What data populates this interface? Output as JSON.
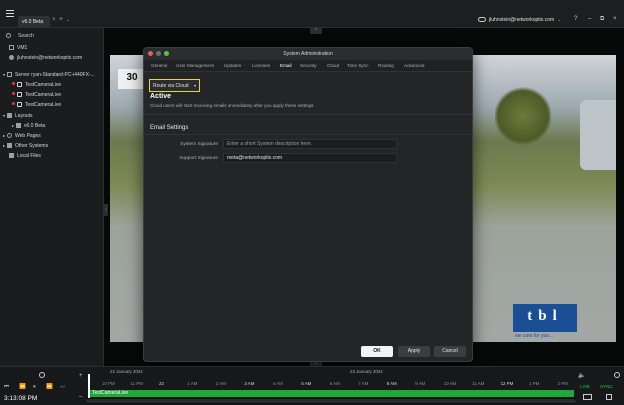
{
  "topbar": {
    "tab_label": "v6.0 Beta",
    "tab_close": "×",
    "tab_add": "+",
    "tab_more": "⌄",
    "user_email": "jluhnstein@networkoptix.com",
    "user_chevron": "⌄",
    "help": "?",
    "minimize": "–",
    "restore": "⧉",
    "close": "×"
  },
  "sidebar": {
    "search_label": "Search",
    "items": [
      {
        "label": "VM1"
      },
      {
        "label": "jluhnstein@networkoptix.com"
      },
      {
        "label": "Server ryan-Standard-PC-i440FX-..."
      },
      {
        "label": "TestCameraLive"
      },
      {
        "label": "TestCameraLive"
      },
      {
        "label": "TestCameraLive"
      },
      {
        "label": "Layouts"
      },
      {
        "label": "v6.0 Beta"
      },
      {
        "label": "Web Pages"
      },
      {
        "label": "Other Systems"
      },
      {
        "label": "Local Files"
      }
    ]
  },
  "scene": {
    "sign_text": "30",
    "logo_text": "tbl",
    "logo_slogan": "we care for you..."
  },
  "dialog": {
    "title": "System Administration",
    "tabs": [
      "General",
      "User Management",
      "Updates",
      "Licenses",
      "Email",
      "Security",
      "Cloud",
      "Time Sync",
      "Routing",
      "Advanced"
    ],
    "active_tab": "Email",
    "route_select": "Route via Cloud",
    "status_title": "Active",
    "status_desc": "Cloud users will start receiving emails immediately after you apply these settings",
    "section_title": "Email Settings",
    "system_signature_label": "System Signature",
    "system_signature_placeholder": "Enter a short System description here.",
    "support_signature_label": "Support Signature",
    "support_signature_value": "meta@networkoptix.com",
    "ok_label": "OK",
    "apply_label": "Apply",
    "cancel_label": "Cancel"
  },
  "timeline": {
    "date_left": "22 January 2024",
    "date_right": "23 January 2024",
    "ticks": [
      "10 PM",
      "11 PM",
      "22",
      "1 AM",
      "2 AM",
      "3 AM",
      "4 AM",
      "5 AM",
      "6 AM",
      "7 AM",
      "8 AM",
      "9 AM",
      "10 AM",
      "11 AM",
      "12 PM",
      "1 PM",
      "2 PM"
    ],
    "bright_ticks": [
      "22",
      "3 AM",
      "5 AM",
      "8 AM",
      "12 PM"
    ],
    "track_label": "TestCameraLive",
    "clock": "3:13:08 PM",
    "live_label": "LIVE",
    "sync_label": "SYNC"
  },
  "colors": {
    "accent_yellow": "#e7d83a",
    "live_green": "#1fa83a",
    "status_red": "#e03b3b",
    "logo_blue": "#1b4f95"
  }
}
